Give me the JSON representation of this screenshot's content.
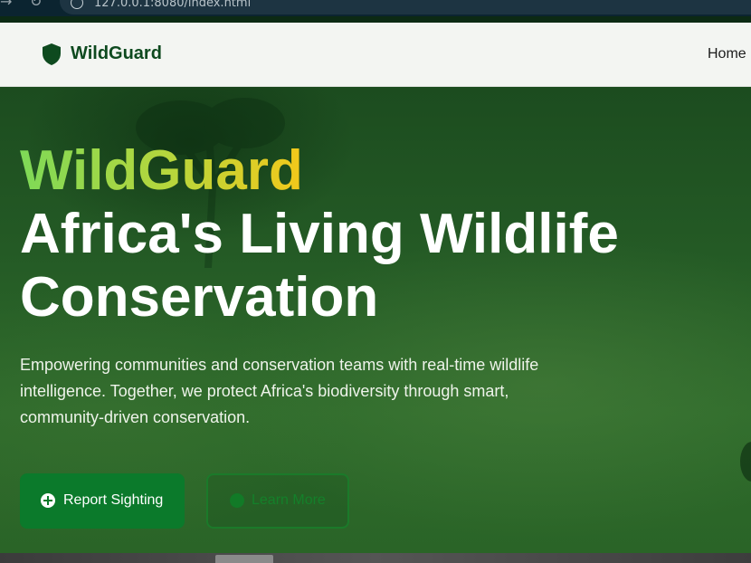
{
  "browser": {
    "url": "127.0.0.1:8080/index.html"
  },
  "header": {
    "logo_text": "WildGuard",
    "nav": {
      "home": "Home"
    }
  },
  "hero": {
    "brand": "WildGuard",
    "title": "Africa's Living Wildlife Conservation",
    "description": "Empowering communities and conservation teams with real-time wildlife intelligence. Together, we protect Africa's biodiversity through smart, community-driven conservation.",
    "buttons": {
      "report": "Report Sighting",
      "learn": "Learn More"
    }
  },
  "colors": {
    "brand_green": "#0e4a1f",
    "accent_gradient_start": "#7ed957",
    "accent_gradient_end": "#f3c81a",
    "button_green": "#0b7a2b"
  },
  "icons": {
    "logo": "shield-icon",
    "report": "plus-circle-icon",
    "learn": "circle-icon"
  }
}
